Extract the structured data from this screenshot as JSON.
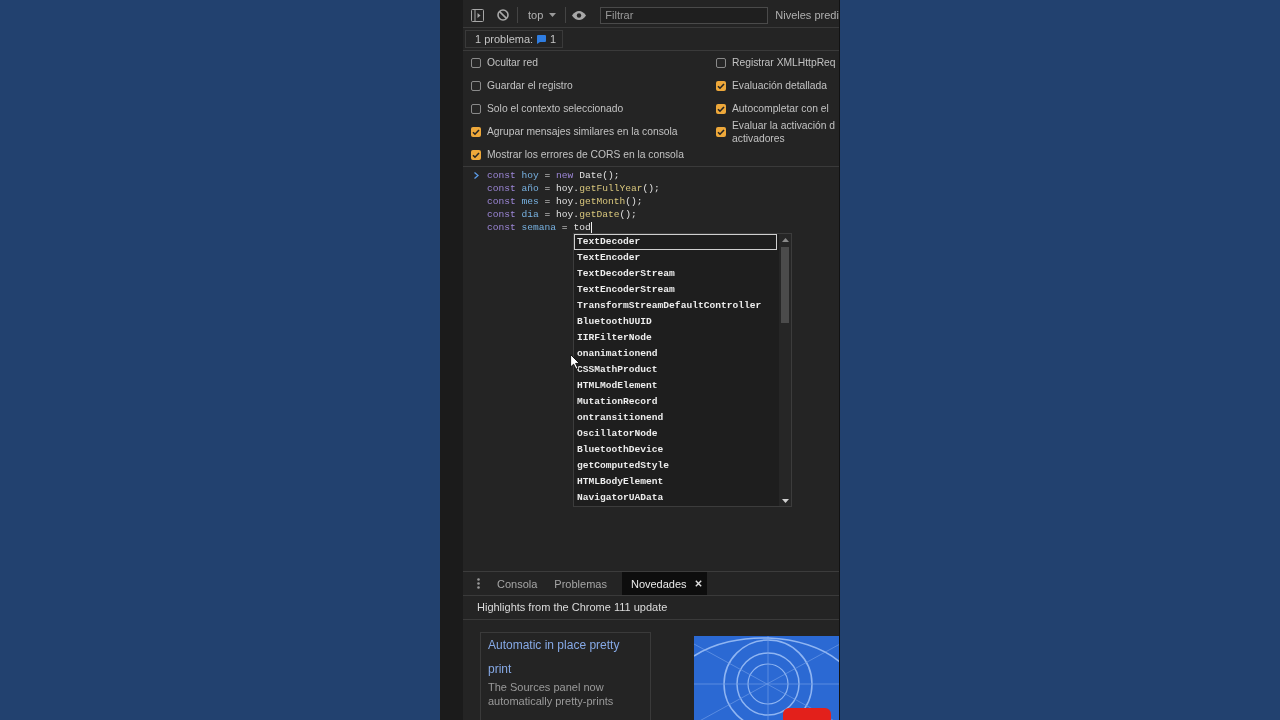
{
  "toolbar": {
    "context": "top",
    "filter": {
      "placeholder": "Filtrar"
    },
    "levels": "Niveles predi"
  },
  "issues": {
    "label": "1 problema:",
    "count": "1"
  },
  "settings": {
    "left": [
      {
        "label": "Ocultar red",
        "checked": false
      },
      {
        "label": "Guardar el registro",
        "checked": false
      },
      {
        "label": "Solo el contexto seleccionado",
        "checked": false
      },
      {
        "label": "Agrupar mensajes similares en la consola",
        "checked": true
      },
      {
        "label": "Mostrar los errores de CORS en la consola",
        "checked": true
      }
    ],
    "right": [
      {
        "label": "Registrar XMLHttpReq",
        "checked": false
      },
      {
        "label": "Evaluación detallada",
        "checked": true
      },
      {
        "label": "Autocompletar con el",
        "checked": true
      },
      {
        "label": "Evaluar la activación d\nactivadores",
        "checked": true
      }
    ]
  },
  "console": {
    "input_caret": true,
    "lines": [
      [
        {
          "kind": "keyword",
          "text": "const"
        },
        {
          "kind": "variable",
          "text": " hoy"
        },
        {
          "kind": "plain",
          "text": " = "
        },
        {
          "kind": "keyword",
          "text": "new"
        },
        {
          "kind": "plain",
          "text": " Date();"
        }
      ],
      [
        {
          "kind": "keyword",
          "text": "const"
        },
        {
          "kind": "variable",
          "text": " año"
        },
        {
          "kind": "plain",
          "text": " = hoy."
        },
        {
          "kind": "function",
          "text": "getFullYear"
        },
        {
          "kind": "plain",
          "text": "();"
        }
      ],
      [
        {
          "kind": "keyword",
          "text": "const"
        },
        {
          "kind": "variable",
          "text": " mes"
        },
        {
          "kind": "plain",
          "text": " = hoy."
        },
        {
          "kind": "function",
          "text": "getMonth"
        },
        {
          "kind": "plain",
          "text": "();"
        }
      ],
      [
        {
          "kind": "keyword",
          "text": "const"
        },
        {
          "kind": "variable",
          "text": " dia"
        },
        {
          "kind": "plain",
          "text": " = hoy."
        },
        {
          "kind": "function",
          "text": "getDate"
        },
        {
          "kind": "plain",
          "text": "();"
        }
      ],
      [
        {
          "kind": "keyword",
          "text": "const"
        },
        {
          "kind": "variable",
          "text": " semana"
        },
        {
          "kind": "plain",
          "text": " = tod"
        }
      ]
    ]
  },
  "autocomplete": {
    "items": [
      {
        "text": "TextDecoder",
        "selected": true
      },
      {
        "text": "TextEncoder",
        "selected": false
      },
      {
        "text": "TextDecoderStream",
        "selected": false
      },
      {
        "text": "TextEncoderStream",
        "selected": false
      },
      {
        "text": "TransformStreamDefaultController",
        "selected": false
      },
      {
        "text": "BluetoothUUID",
        "selected": false
      },
      {
        "text": "IIRFilterNode",
        "selected": false
      },
      {
        "text": "onanimationend",
        "selected": false
      },
      {
        "text": "CSSMathProduct",
        "selected": false
      },
      {
        "text": "HTMLModElement",
        "selected": false
      },
      {
        "text": "MutationRecord",
        "selected": false
      },
      {
        "text": "ontransitionend",
        "selected": false
      },
      {
        "text": "OscillatorNode",
        "selected": false
      },
      {
        "text": "BluetoothDevice",
        "selected": false
      },
      {
        "text": "getComputedStyle",
        "selected": false
      },
      {
        "text": "HTMLBodyElement",
        "selected": false
      },
      {
        "text": "NavigatorUAData",
        "selected": false
      }
    ]
  },
  "drawer": {
    "tabs": [
      {
        "label": "Consola",
        "selected": false,
        "closable": false
      },
      {
        "label": "Problemas",
        "selected": false,
        "closable": false
      },
      {
        "label": "Novedades",
        "selected": true,
        "closable": true
      }
    ],
    "heading": "Highlights from the Chrome 111 update",
    "card": {
      "title": "Automatic in place pretty print",
      "description": "The Sources panel now automatically pretty-prints"
    }
  }
}
